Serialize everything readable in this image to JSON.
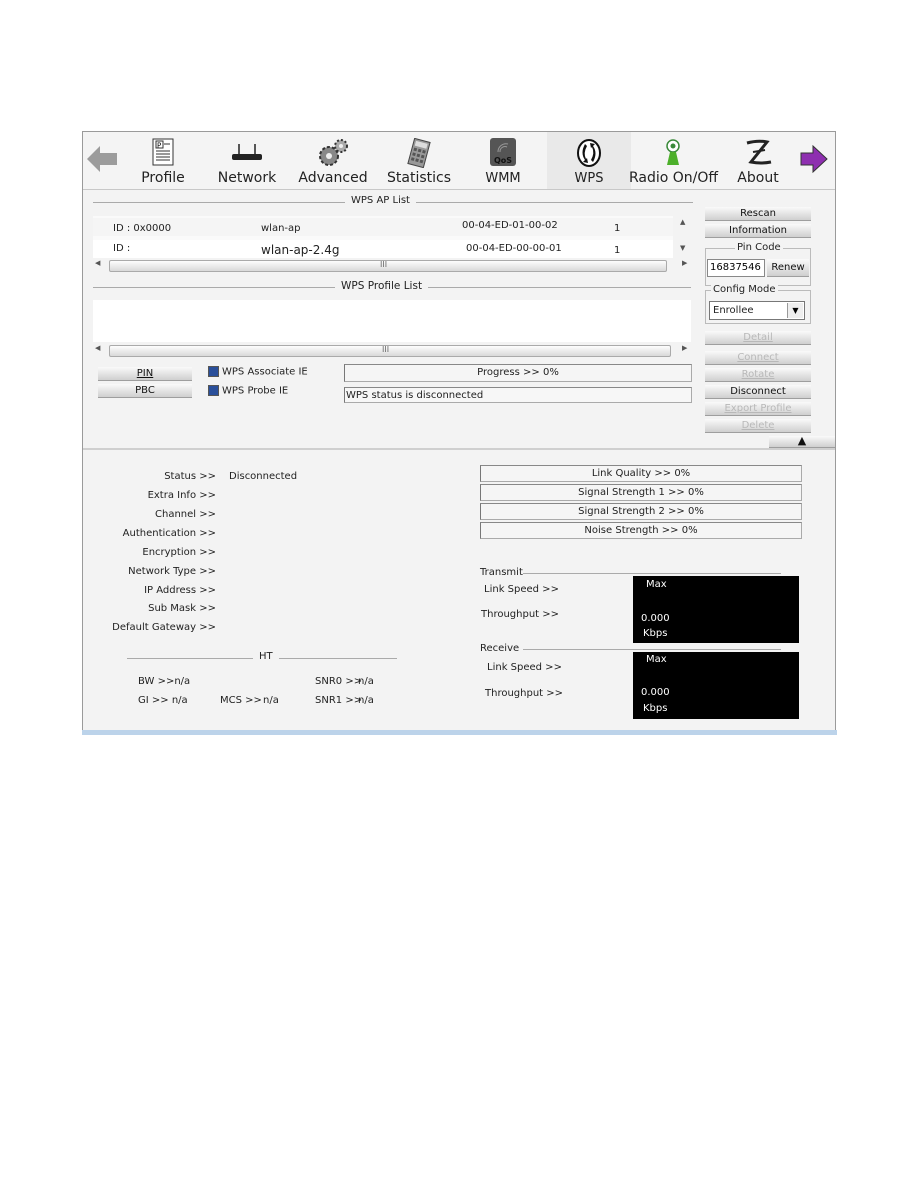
{
  "toolbar": {
    "back_icon": "arrow-left-icon",
    "forward_icon": "arrow-right-icon",
    "items": [
      {
        "label": "Profile",
        "icon": "profile-document-icon"
      },
      {
        "label": "Network",
        "icon": "router-icon"
      },
      {
        "label": "Advanced",
        "icon": "gears-icon"
      },
      {
        "label": "Statistics",
        "icon": "calculator-icon"
      },
      {
        "label": "WMM",
        "icon": "qos-icon",
        "icon_text": "QoS"
      },
      {
        "label": "WPS",
        "icon": "wps-icon",
        "active": true
      },
      {
        "label": "Radio On/Off",
        "icon": "radio-antenna-icon"
      },
      {
        "label": "About",
        "icon": "about-logo-icon"
      }
    ]
  },
  "wps_ap_list": {
    "title": "WPS AP List",
    "rows": [
      {
        "id": "ID : 0x0000",
        "ssid": "wlan-ap",
        "bssid": "00-04-ED-01-00-02",
        "channel": "1"
      },
      {
        "id": "ID :",
        "ssid": "wlan-ap-2.4g",
        "bssid": "00-04-ED-00-00-01",
        "channel": "1"
      }
    ],
    "scroll_grip": "III"
  },
  "wps_profile_list": {
    "title": "WPS Profile List",
    "rows": [],
    "scroll_grip": "III"
  },
  "side_buttons": {
    "rescan": "Rescan",
    "information": "Information",
    "pin_code_legend": "Pin Code",
    "pin_code_value": "16837546",
    "renew": "Renew",
    "config_mode_legend": "Config Mode",
    "config_mode_value": "Enrollee",
    "detail": "Detail",
    "connect": "Connect",
    "rotate": "Rotate",
    "disconnect": "Disconnect",
    "export_profile": "Export Profile",
    "delete": "Delete"
  },
  "wps_controls": {
    "pin": "PIN",
    "pbc": "PBC",
    "associate_ie": {
      "label": "WPS Associate IE",
      "checked": true
    },
    "probe_ie": {
      "label": "WPS Probe IE",
      "checked": true
    },
    "progress_label": "Progress >> 0%",
    "progress_value": 0,
    "status_text": "WPS status is disconnected"
  },
  "connection_info": {
    "fields": [
      {
        "label": "Status >>",
        "value": "Disconnected"
      },
      {
        "label": "Extra Info >>",
        "value": ""
      },
      {
        "label": "Channel >>",
        "value": ""
      },
      {
        "label": "Authentication >>",
        "value": ""
      },
      {
        "label": "Encryption >>",
        "value": ""
      },
      {
        "label": "Network Type >>",
        "value": ""
      },
      {
        "label": "IP Address >>",
        "value": ""
      },
      {
        "label": "Sub Mask >>",
        "value": ""
      },
      {
        "label": "Default Gateway >>",
        "value": ""
      }
    ]
  },
  "ht": {
    "title": "HT",
    "bw": "BW >>n/a",
    "gi": "GI >> n/a",
    "mcs": "MCS >>",
    "mcs_value": "n/a",
    "snr0": "SNR0 >>",
    "snr0_value": "n/a",
    "snr1": "SNR1 >>",
    "snr1_value": "n/a"
  },
  "quality_bars": [
    {
      "label": "Link Quality >> 0%",
      "value": 0
    },
    {
      "label": "Signal Strength 1 >> 0%",
      "value": 0
    },
    {
      "label": "Signal Strength 2 >> 0%",
      "value": 0
    },
    {
      "label": "Noise Strength >> 0%",
      "value": 0
    }
  ],
  "transmit": {
    "title": "Transmit",
    "link_speed_label": "Link Speed >>",
    "throughput_label": "Throughput >>",
    "max": "Max",
    "value": "0.000",
    "unit": "Kbps"
  },
  "receive": {
    "title": "Receive",
    "link_speed_label": "Link Speed >>",
    "throughput_label": "Throughput >>",
    "max": "Max",
    "value": "0.000",
    "unit": "Kbps"
  }
}
